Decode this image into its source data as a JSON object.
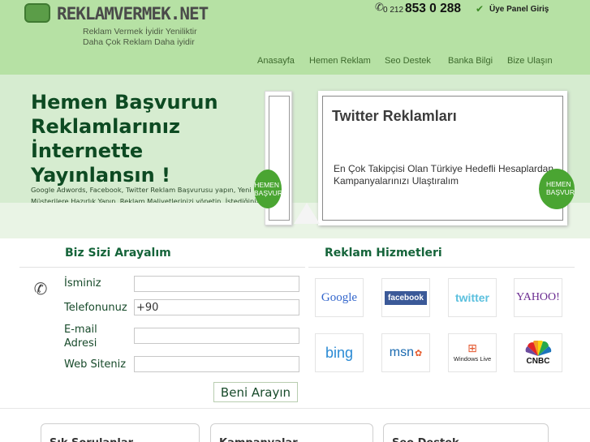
{
  "header": {
    "logo_text": "REKLAMVERMEK.NET",
    "tagline_1": "Reklam Vermek İyidir Yeniliktir",
    "tagline_2": "Daha Çok Reklam Daha iyidir",
    "phone_prefix": "0 212",
    "phone_number": "853 0 288",
    "member_login": "Üye Panel Giriş"
  },
  "nav": {
    "items": [
      {
        "label": "Anasayfa"
      },
      {
        "label": "Hemen Reklam"
      },
      {
        "label": "Seo Destek"
      },
      {
        "label": "Banka Bilgi"
      },
      {
        "label": "Bize Ulaşın"
      }
    ]
  },
  "hero": {
    "title": "Hemen Başvurun Reklamlarınız İnternette Yayınlansın !",
    "description": "Google Adwords, Facebook, Twitter Reklam Başvurusu yapın, Yeni Müşterilere Hazırlık Yapın. Reklam Maliyetlerinizi yönetin, İstediğiniz zaman dilimlerinde reklamlarınızın yayınlanmasını sağlayın.",
    "slide_title": "Twitter Reklamları",
    "slide_text": "En Çok Takipçisi Olan Türkiye Hedefli Hesaplardan Kampanyalarınızı Ulaştıralım",
    "badge_text": "HEMEN BAŞVUR",
    "prev_badge_text": "HEMEN BAŞVUR"
  },
  "callback": {
    "title": "Biz Sizi Arayalım",
    "fields": [
      {
        "label": "İsminiz",
        "value": ""
      },
      {
        "label": "Telefonunuz",
        "value": "+90"
      },
      {
        "label": "E-mail Adresi",
        "value": ""
      },
      {
        "label": "Web Siteniz",
        "value": ""
      }
    ],
    "submit_label": "Beni Arayın"
  },
  "services": {
    "title": "Reklam Hizmetleri",
    "brands": [
      {
        "name": "Google",
        "color": "#3366cc"
      },
      {
        "name": "facebook",
        "color": "#3b5998"
      },
      {
        "name": "twitter",
        "color": "#5bc0de"
      },
      {
        "name": "YAHOO!",
        "color": "#6b2c91"
      },
      {
        "name": "bing",
        "color": "#2a8ad4"
      },
      {
        "name": "msn",
        "color": "#1a6ab0"
      },
      {
        "name": "Windows Live",
        "color": "#222222"
      },
      {
        "name": "CNBC",
        "color": "#111111"
      }
    ]
  },
  "footer_cards": [
    {
      "label": "Sık Sorulanlar"
    },
    {
      "label": "Kampanyalar"
    },
    {
      "label": "Seo Destek"
    }
  ],
  "colors": {
    "header_bg": "#b6e1a4",
    "hero_bg": "#d6ecd0",
    "title_green": "#0d4a22",
    "accent_green": "#4aa532"
  }
}
